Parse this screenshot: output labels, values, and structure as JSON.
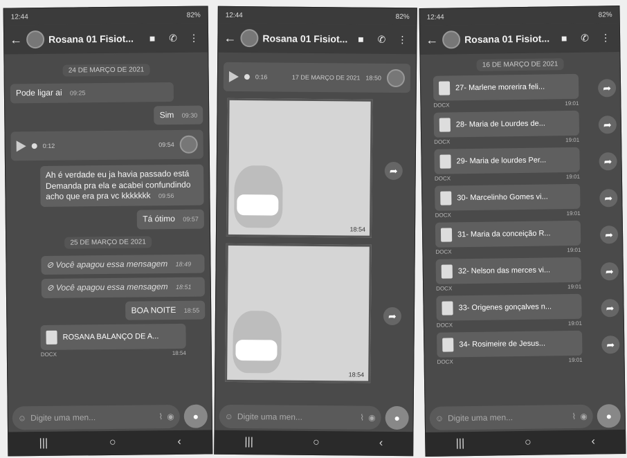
{
  "phone1": {
    "status": {
      "time": "12:44",
      "battery": "82%"
    },
    "contact": "Rosana 01 Fisiot...",
    "date1": "24 DE MARÇO DE 2021",
    "msgs": [
      {
        "text": "Pode ligar ai",
        "time": "09:25",
        "dir": "in"
      },
      {
        "text": "Sim",
        "time": "09:30",
        "dir": "out"
      }
    ],
    "voice": {
      "duration": "0:12",
      "time": "09:54"
    },
    "long_msg": {
      "text": "Ah é verdade eu ja havia passado está Demanda pra ela e acabei confundindo acho que era pra vc kkkkkkk",
      "time": "09:56"
    },
    "reply": {
      "text": "Tá ótimo",
      "time": "09:57"
    },
    "date2": "25 DE MARÇO DE 2021",
    "deleted": [
      {
        "text": "Você apagou essa mensagem",
        "time": "18:49"
      },
      {
        "text": "Você apagou essa mensagem",
        "time": "18:51"
      }
    ],
    "night": {
      "text": "BOA NOITE",
      "time": "18:55"
    },
    "doc": {
      "name": "ROSANA BALANÇO DE A...",
      "type": "DOCX",
      "time": "18:54"
    },
    "placeholder": "Digite uma men..."
  },
  "phone2": {
    "status": {
      "time": "12:44",
      "battery": "82%"
    },
    "contact": "Rosana 01 Fisiot...",
    "date": "17 DE MARÇO DE 2021",
    "voice": {
      "duration": "0:16",
      "time": "18:50"
    },
    "photo1_time": "18:54",
    "photo2_time": "18:54",
    "placeholder": "Digite uma men..."
  },
  "phone3": {
    "status": {
      "time": "12:44",
      "battery": "82%"
    },
    "contact": "Rosana 01 Fisiot...",
    "date": "16 DE MARÇO DE 2021",
    "docs": [
      {
        "name": "27- Marlene morerira feli...",
        "type": "DOCX",
        "time": "19:01"
      },
      {
        "name": "28- Maria de Lourdes de...",
        "type": "DOCX",
        "time": "19:01"
      },
      {
        "name": "29- Maria de lourdes Per...",
        "type": "DOCX",
        "time": "19:01"
      },
      {
        "name": "30- Marcelinho Gomes vi...",
        "type": "DOCX",
        "time": "19:01"
      },
      {
        "name": "31- Maria da conceição R...",
        "type": "DOCX",
        "time": "19:01"
      },
      {
        "name": "32- Nelson das merces vi...",
        "type": "DOCX",
        "time": "19:01"
      },
      {
        "name": "33- Origenes gonçalves n...",
        "type": "DOCX",
        "time": "19:01"
      },
      {
        "name": "34- Rosimeire de Jesus...",
        "type": "DOCX",
        "time": "19:01"
      }
    ],
    "placeholder": "Digite uma men..."
  }
}
